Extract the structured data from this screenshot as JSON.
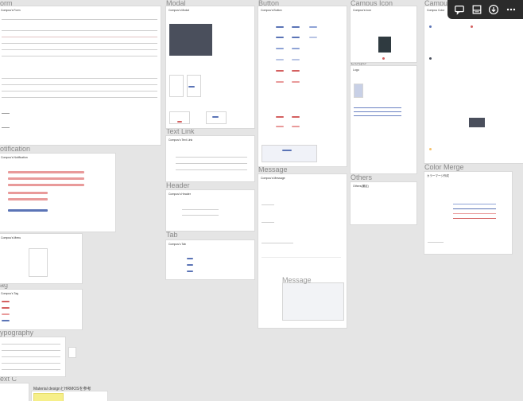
{
  "sections": {
    "form": "orm",
    "modal": "Modal",
    "button": "Button",
    "campus_icon": "Campus Icon",
    "campus_colors": "Campu",
    "logo": "Logo",
    "text_link": "Text Link",
    "message": "Message",
    "others": "Others",
    "color_merge": "Color Merge",
    "header": "Header",
    "tab": "Tab",
    "notification": "otification",
    "menu": "enu",
    "tag": "ag",
    "typography": "ypography",
    "text_c": "ext C",
    "message_overlay": "Message"
  },
  "boards": {
    "form": "Compus's Form",
    "modal": "Compus's Modal",
    "button": "Compus's Button",
    "campus_icon": "Compus's Icon",
    "logo": "Logo",
    "text_link": "Compus's Text Link",
    "message": "Compus's Message",
    "others": "Others(補足)",
    "color_merge": "カラーマージ作成",
    "header": "Compus's Header",
    "tab": "Compus's Tab",
    "notification": "Compus's Notification",
    "menu": "Compus's Menu",
    "tag": "Compus's Tag",
    "campus_colors": "Compus Color"
  },
  "note": "Material designとHRMOSを参考",
  "toolbar": {
    "comment": "comment-icon",
    "inspect": "inspect-icon",
    "download": "download-icon",
    "more": "more-icon"
  },
  "colors": {
    "blue": "#5b74b6",
    "red": "#d46060",
    "pink": "#e99a9a",
    "dark": "#4a4f5c",
    "yellow": "#f6ef8a"
  }
}
